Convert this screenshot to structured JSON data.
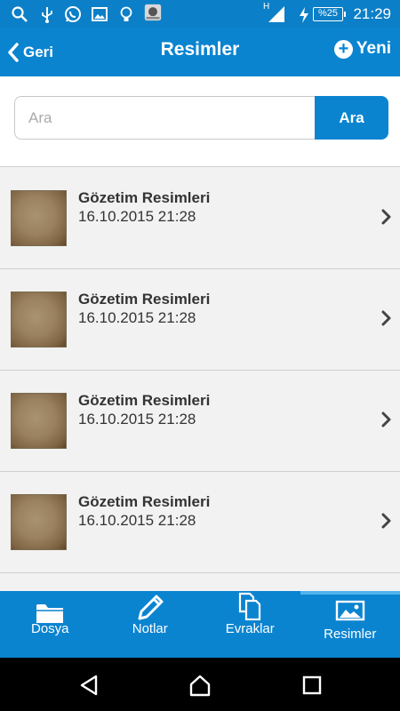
{
  "status_bar": {
    "time": "21:29",
    "battery": "%25",
    "network": "H",
    "icons": [
      "search-icon",
      "usb-icon",
      "whatsapp-icon",
      "image-icon",
      "bulb-icon",
      "app-icon",
      "signal-icon",
      "charging-icon"
    ]
  },
  "app_bar": {
    "back_label": "Geri",
    "title": "Resimler",
    "new_label": "Yeni"
  },
  "search": {
    "placeholder": "Ara",
    "value": "",
    "button_label": "Ara"
  },
  "items": [
    {
      "title": "Gözetim Resimleri",
      "date": "16.10.2015 21:28"
    },
    {
      "title": "Gözetim Resimleri",
      "date": "16.10.2015 21:28"
    },
    {
      "title": "Gözetim Resimleri",
      "date": "16.10.2015 21:28"
    },
    {
      "title": "Gözetim Resimleri",
      "date": "16.10.2015 21:28"
    }
  ],
  "tabs": [
    {
      "label": "Dosya",
      "icon": "folder-icon",
      "active": false
    },
    {
      "label": "Notlar",
      "icon": "pencil-icon",
      "active": false
    },
    {
      "label": "Evraklar",
      "icon": "documents-icon",
      "active": false
    },
    {
      "label": "Resimler",
      "icon": "picture-icon",
      "active": true
    }
  ],
  "colors": {
    "primary": "#0b84d0",
    "status_bar": "#0b7fc7",
    "active_indicator": "#4fb3ee",
    "background": "#f2f2f2"
  }
}
